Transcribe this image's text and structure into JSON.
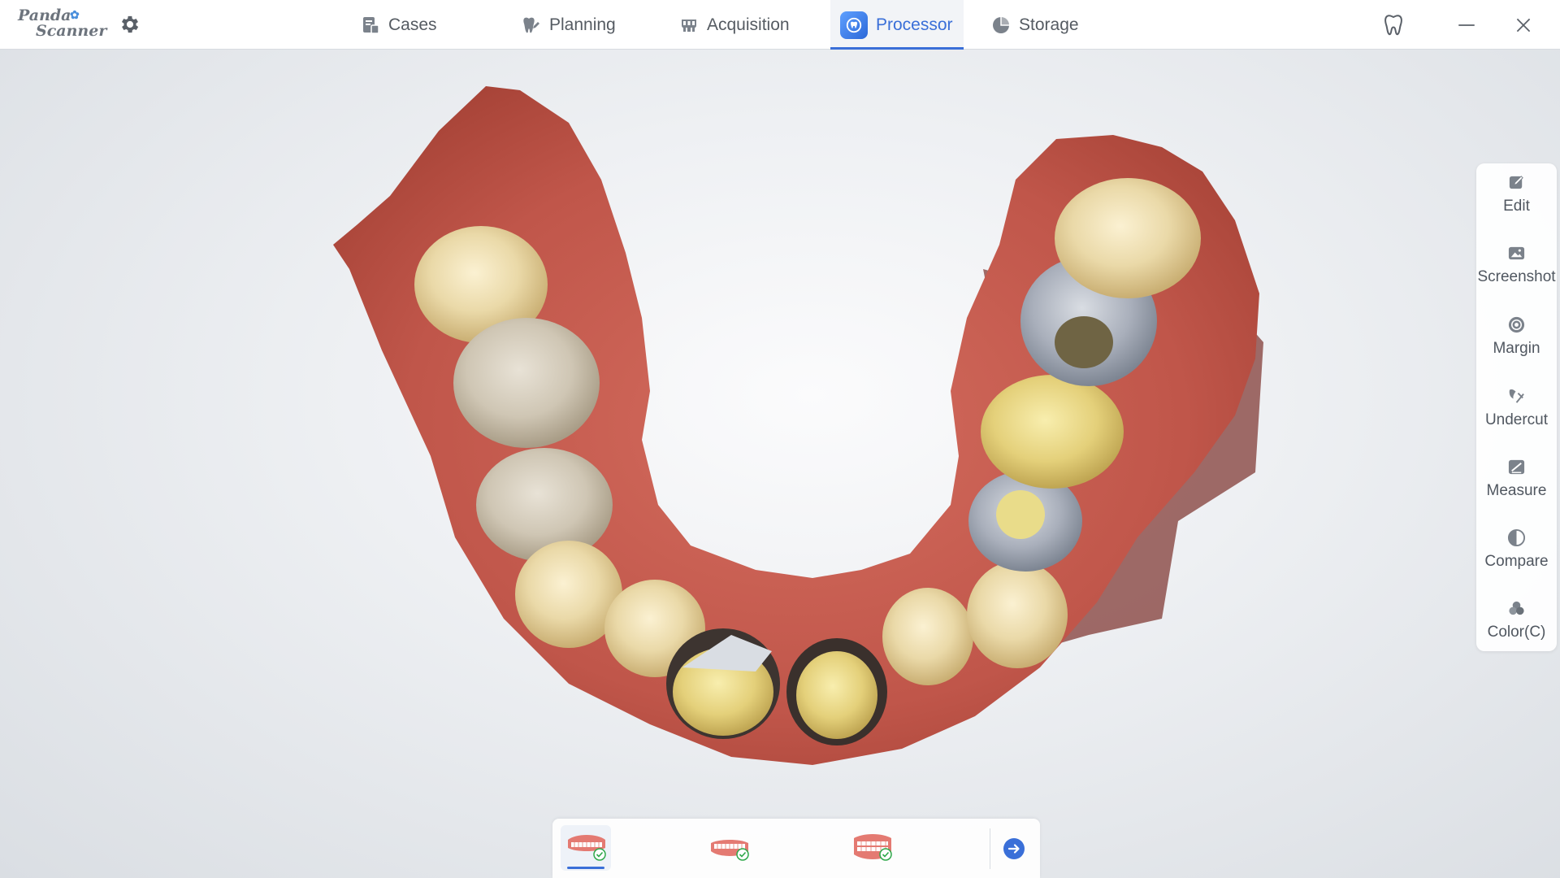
{
  "app": {
    "logo_line1": "Panda",
    "logo_line2": "Scanner",
    "accent_color": "#3a6fd8"
  },
  "tabs": [
    {
      "label": "Cases",
      "icon": "cases-icon",
      "active": false
    },
    {
      "label": "Planning",
      "icon": "planning-icon",
      "active": false
    },
    {
      "label": "Acquisition",
      "icon": "acquisition-icon",
      "active": false
    },
    {
      "label": "Processor",
      "icon": "processor-icon",
      "active": true
    },
    {
      "label": "Storage",
      "icon": "storage-icon",
      "active": false
    }
  ],
  "tools": [
    {
      "label": "Edit",
      "icon": "edit-icon"
    },
    {
      "label": "Screenshot",
      "icon": "screenshot-icon"
    },
    {
      "label": "Margin",
      "icon": "margin-icon"
    },
    {
      "label": "Undercut",
      "icon": "undercut-icon"
    },
    {
      "label": "Measure",
      "icon": "measure-icon"
    },
    {
      "label": "Compare",
      "icon": "compare-icon"
    },
    {
      "label": "Color(C)",
      "icon": "color-icon"
    }
  ],
  "jaws": [
    {
      "name": "upper-jaw",
      "done": true,
      "active": true
    },
    {
      "name": "lower-jaw",
      "done": true,
      "active": false
    },
    {
      "name": "bite",
      "done": true,
      "active": false
    }
  ]
}
